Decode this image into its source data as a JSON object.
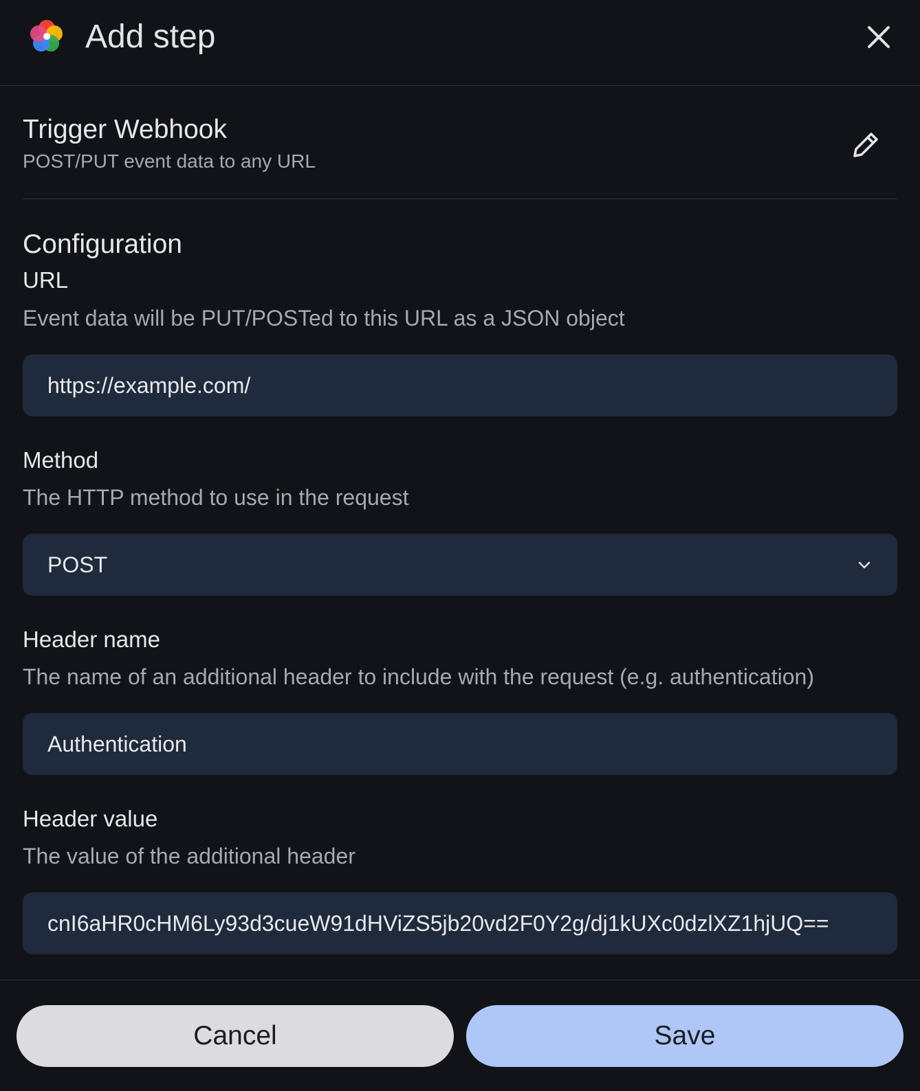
{
  "header": {
    "title": "Add step",
    "logo_icon": "pinwheel-logo-icon",
    "close_icon": "close-icon"
  },
  "step": {
    "title": "Trigger Webhook",
    "subtitle": "POST/PUT event data to any URL",
    "edit_icon": "pencil-icon"
  },
  "configuration": {
    "title": "Configuration",
    "url": {
      "label": "URL",
      "help": "Event data will be PUT/POSTed to this URL as a JSON object",
      "value": "https://example.com/"
    },
    "method": {
      "label": "Method",
      "help": "The HTTP method to use in the request",
      "value": "POST"
    },
    "header_name": {
      "label": "Header name",
      "help": "The name of an additional header to include with the request (e.g. authentication)",
      "value": "Authentication"
    },
    "header_value": {
      "label": "Header value",
      "help": "The value of the additional header",
      "value": "cnI6aHR0cHM6Ly93d3cueW91dHViZS5jb20vd2F0Y2g/dj1kUXc0dzlXZ1hjUQ=="
    }
  },
  "footer": {
    "cancel_label": "Cancel",
    "save_label": "Save"
  },
  "colors": {
    "background": "#111318",
    "field_background": "#1f2a3c",
    "save_button": "#aec7f7",
    "cancel_button": "#dcdcdf"
  }
}
